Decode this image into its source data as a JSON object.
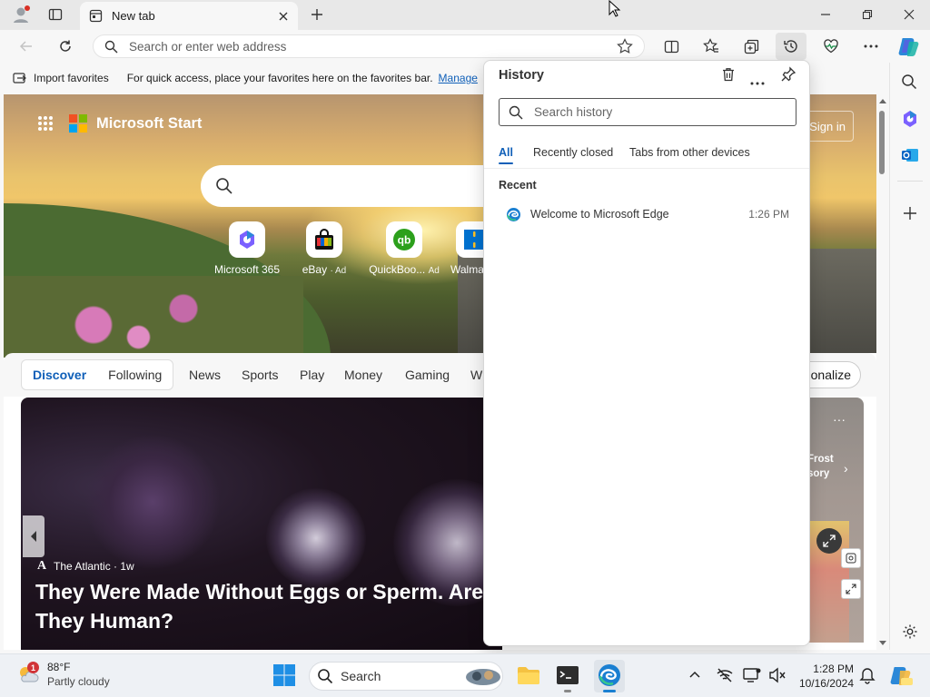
{
  "browser": {
    "tab": {
      "title": "New tab"
    },
    "address_bar": {
      "placeholder": "Search or enter web address"
    },
    "favorites_bar": {
      "import_label": "Import favorites",
      "message": "For quick access, place your favorites here on the favorites bar.",
      "manage_link": "Manage"
    }
  },
  "newtab": {
    "brand": "Microsoft Start",
    "sign_in": "Sign in",
    "quick_links": [
      {
        "label": "Microsoft 365",
        "ad": ""
      },
      {
        "label": "eBay",
        "ad": "· Ad"
      },
      {
        "label": "QuickBoo...",
        "ad": "Ad"
      },
      {
        "label": "Walma",
        "ad": ""
      }
    ],
    "feed_tabs": [
      "Discover",
      "Following"
    ],
    "feed_nav": [
      "News",
      "Sports",
      "Play",
      "Money",
      "Gaming",
      "W"
    ],
    "personalize": "onalize",
    "article": {
      "source": "The Atlantic · 1w",
      "source_logo": "A",
      "title": "They Were Made Without Eggs or Sperm. Are They Human?"
    },
    "side_card": {
      "text": "Frost\nsory"
    }
  },
  "history": {
    "title": "History",
    "search_placeholder": "Search history",
    "tabs": [
      "All",
      "Recently closed",
      "Tabs from other devices"
    ],
    "selected_tab": "All",
    "section": "Recent",
    "items": [
      {
        "title": "Welcome to Microsoft Edge",
        "time": "1:26 PM"
      }
    ]
  },
  "taskbar": {
    "weather": {
      "temp": "88°F",
      "condition": "Partly cloudy",
      "badge": "1"
    },
    "search_label": "Search",
    "time": "1:28 PM",
    "date": "10/16/2024"
  },
  "colors": {
    "accent": "#0f5fb8",
    "edge_blue": "#1a7fd1"
  }
}
